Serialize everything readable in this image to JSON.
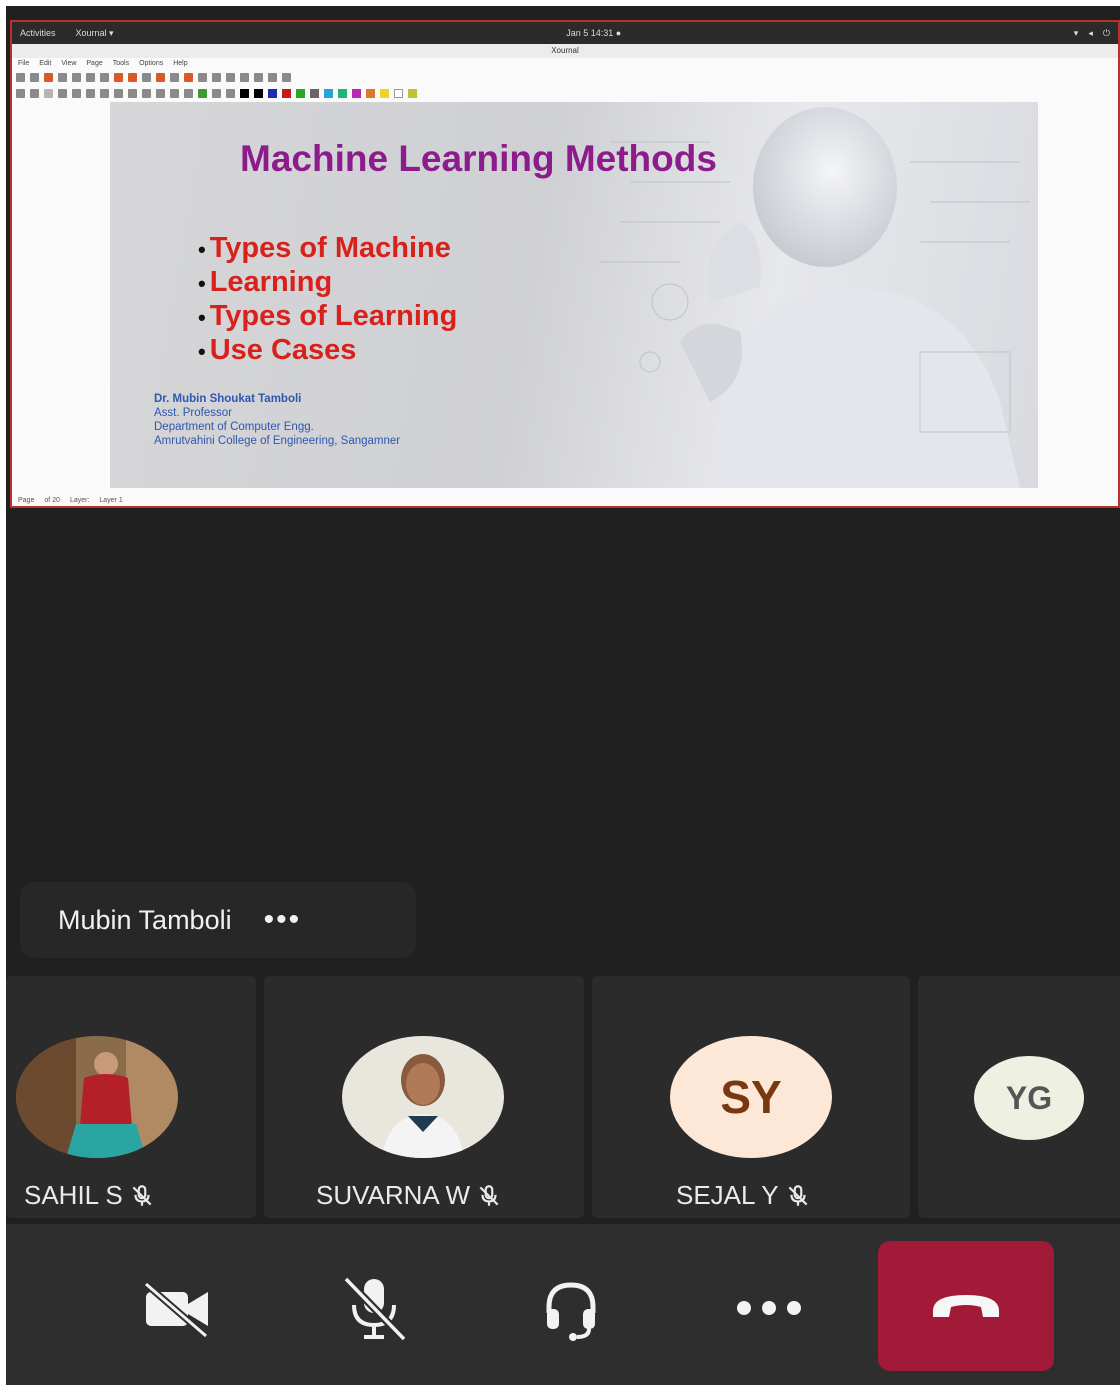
{
  "shared_screen": {
    "os_bar": {
      "activities": "Activities",
      "app_menu": "Xournal ▾",
      "clock": "Jan 5 14:31 ●"
    },
    "window_title": "Xournal",
    "menu": [
      "File",
      "Edit",
      "View",
      "Page",
      "Tools",
      "Options",
      "Help"
    ],
    "slide": {
      "title": "Machine Learning Methods",
      "bullets": [
        "Types of Machine",
        "Learning",
        "Types of Learning",
        "Use Cases"
      ],
      "author": {
        "name": "Dr. Mubin Shoukat Tamboli",
        "role": "Asst. Professor",
        "department": "Department of Computer Engg.",
        "college": "Amrutvahini College of Engineering, Sangamner"
      }
    },
    "status": {
      "page_label": "Page",
      "page_of": "of 20",
      "layer_label": "Layer:",
      "layer_value": "Layer 1"
    }
  },
  "presenter": {
    "name": "Mubin Tamboli",
    "more_icon": "more-horizontal-icon"
  },
  "participants": [
    {
      "name": "SAHIL S",
      "avatar": "photo",
      "muted": true
    },
    {
      "name": "SUVARNA W",
      "avatar": "photo",
      "muted": true
    },
    {
      "name": "SEJAL Y",
      "initials": "SY",
      "muted": true,
      "color": "#fde8d7"
    },
    {
      "name": "",
      "initials": "YG",
      "muted": false,
      "color": "#eef0e2"
    }
  ],
  "controls": {
    "camera": "camera-off-icon",
    "mic": "mic-off-icon",
    "audio": "headset-icon",
    "more": "more-horizontal-icon",
    "hangup": "hang-up-icon",
    "hangup_color": "#a11a37"
  }
}
